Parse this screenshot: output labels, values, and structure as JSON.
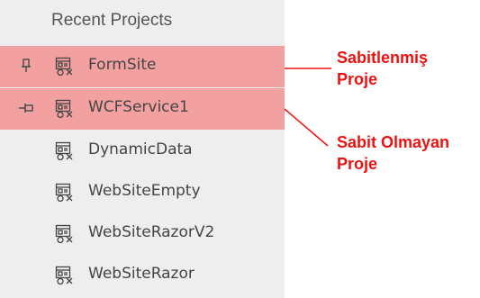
{
  "panel": {
    "title": "Recent Projects"
  },
  "projects": [
    {
      "name": "FormSite",
      "pin": "pinned-pin-icon",
      "highlighted": true
    },
    {
      "name": "WCFService1",
      "pin": "unpinned-pin-icon",
      "highlighted": true
    },
    {
      "name": "DynamicData",
      "pin": "",
      "highlighted": false
    },
    {
      "name": "WebSiteEmpty",
      "pin": "",
      "highlighted": false
    },
    {
      "name": "WebSiteRazorV2",
      "pin": "",
      "highlighted": false
    },
    {
      "name": "WebSiteRazor",
      "pin": "",
      "highlighted": false
    }
  ],
  "annotations": {
    "pinned": {
      "line1": "Sabitlenmiş",
      "line2": "Proje"
    },
    "unpinned": {
      "line1": "Sabit Olmayan",
      "line2": "Proje"
    }
  },
  "colors": {
    "highlight": "#f2a0a0",
    "annotation": "#ee1111",
    "panel_bg": "#eeeeee"
  },
  "icons": {
    "project": "web-project-icon"
  }
}
